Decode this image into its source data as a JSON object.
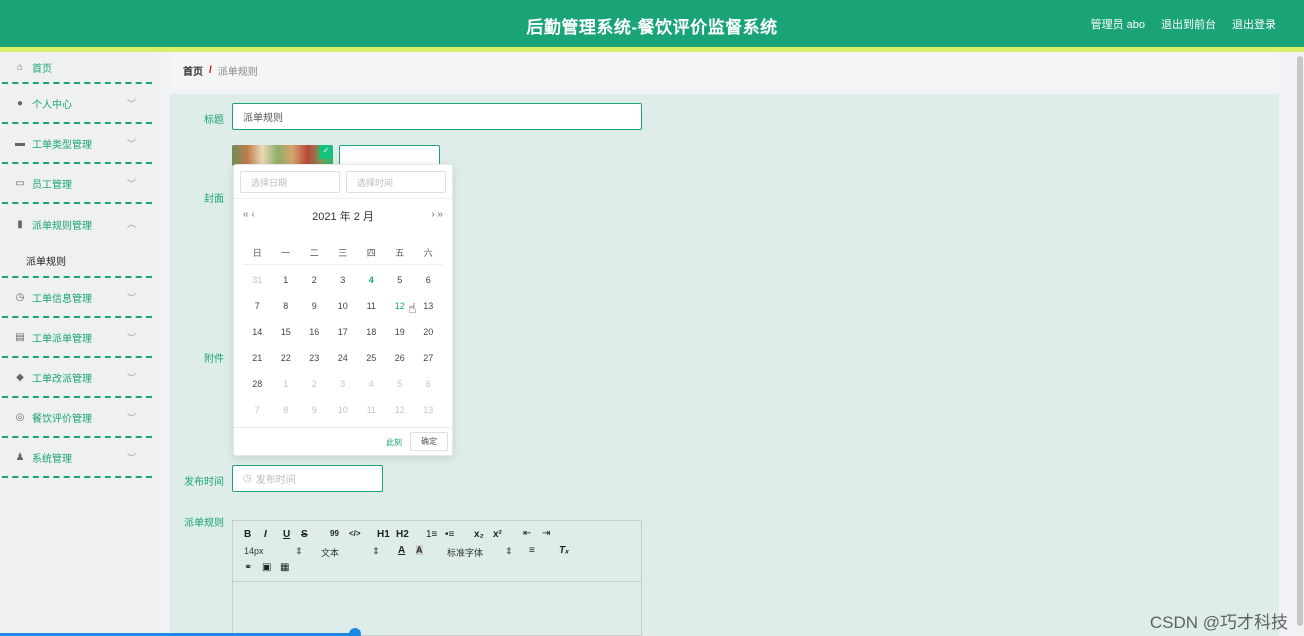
{
  "header": {
    "title": "后勤管理系统-餐饮评价监督系统",
    "user": "管理员 abo",
    "to_front": "退出到前台",
    "logout": "退出登录"
  },
  "sidebar": {
    "items": [
      {
        "label": "首页",
        "icon": "home-icon"
      },
      {
        "label": "个人中心",
        "icon": "user-icon"
      },
      {
        "label": "工单类型管理",
        "icon": "monitor-icon"
      },
      {
        "label": "员工管理",
        "icon": "chat-icon"
      },
      {
        "label": "派单规则管理",
        "icon": "books-icon"
      },
      {
        "label": "工单信息管理",
        "icon": "clock-icon"
      },
      {
        "label": "工单派单管理",
        "icon": "clipboard-icon"
      },
      {
        "label": "工单改派管理",
        "icon": "location-icon"
      },
      {
        "label": "餐饮评价管理",
        "icon": "gauge-icon"
      },
      {
        "label": "系统管理",
        "icon": "user-settings-icon"
      }
    ],
    "submenu": "派单规则"
  },
  "breadcrumb": {
    "home": "首页",
    "separator": "/",
    "current": "派单规则"
  },
  "form": {
    "title_label": "标题",
    "title_value": "派单规则",
    "cover_label": "封面",
    "attachment_label": "附件",
    "publish_label": "发布时间",
    "publish_placeholder": "发布时间",
    "rules_label": "派单规则"
  },
  "datepicker": {
    "date_placeholder": "选择日期",
    "time_placeholder": "选择时间",
    "prev": "«  ‹",
    "next": "›  »",
    "header": "2021 年  2 月",
    "weekdays": [
      "日",
      "一",
      "二",
      "三",
      "四",
      "五",
      "六"
    ],
    "weeks": [
      [
        "31",
        "1",
        "2",
        "3",
        "4",
        "5",
        "6"
      ],
      [
        "7",
        "8",
        "9",
        "10",
        "11",
        "12",
        "13"
      ],
      [
        "14",
        "15",
        "16",
        "17",
        "18",
        "19",
        "20"
      ],
      [
        "21",
        "22",
        "23",
        "24",
        "25",
        "26",
        "27"
      ],
      [
        "28",
        "1",
        "2",
        "3",
        "4",
        "5",
        "6"
      ],
      [
        "7",
        "8",
        "9",
        "10",
        "11",
        "12",
        "13"
      ]
    ],
    "now": "此刻",
    "ok": "确定"
  },
  "editor": {
    "bold": "B",
    "italic": "I",
    "underline": "U",
    "strike": "S",
    "quote": "99",
    "code": "</>",
    "h1": "H1",
    "h2": "H2",
    "ol": "1≡",
    "ul": "•≡",
    "sub": "x₂",
    "sup": "x²",
    "outdent": "⇤",
    "indent": "⇥",
    "size": "14px",
    "type": "文本",
    "font": "标准字体"
  },
  "watermark": "CSDN @巧才科技"
}
